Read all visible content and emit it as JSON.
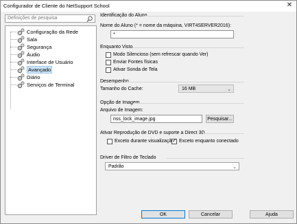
{
  "window": {
    "title": "Configurador de Cliente do NetSupport School",
    "close_glyph": "✕"
  },
  "search": {
    "placeholder": "Definições de pesquisa"
  },
  "tree": {
    "items": [
      {
        "label": "Configuração da Rede"
      },
      {
        "label": "Sala"
      },
      {
        "label": "Segurança"
      },
      {
        "label": "Áudio"
      },
      {
        "label": "Interface de Usuário"
      },
      {
        "label": "Avançado"
      },
      {
        "label": "Diário"
      },
      {
        "label": "Serviços de Terminal"
      }
    ],
    "selected": "Avançado"
  },
  "ident": {
    "title": "Identificação do Aluno",
    "name_label": "Nome do Aluno (* = nome da máquina, VIRT4SERVER2016):",
    "name_value": "*"
  },
  "view": {
    "title": "Enquanto Visto",
    "options": [
      {
        "label": "Modo Silencioso (sem refrescar quando Ver)",
        "checked": false
      },
      {
        "label": "Enviar Fontes físicas",
        "checked": false
      },
      {
        "label": "Ativar Sonda de Tela",
        "checked": false
      }
    ]
  },
  "perf": {
    "title": "Desempenho",
    "cache_label": "Tamanho do Cache:",
    "cache_value": "16 MB"
  },
  "image": {
    "title": "Opção de Imagem",
    "file_label": "Arquivo de Imagem:",
    "file_value": "nss_lock_image.jpg",
    "browse": "Pesquisar..."
  },
  "dvd": {
    "title": "Ativar Reprodução de DVD e suporte a Direct 3D",
    "options": [
      {
        "label": "Exceto durante visualização",
        "checked": false
      },
      {
        "label": "Exceto enquanto conectado",
        "checked": true
      }
    ]
  },
  "keyboard": {
    "title": "Driver de Filtro de Teclado",
    "value": "Padrão"
  },
  "buttons": {
    "ok": "OK",
    "cancel": "Cancelar",
    "help": "Ajuda"
  },
  "colors": {
    "selection": "#cce4f7",
    "default_button_border": "#0078d7",
    "dialog_bg": "#f0f0f0"
  }
}
